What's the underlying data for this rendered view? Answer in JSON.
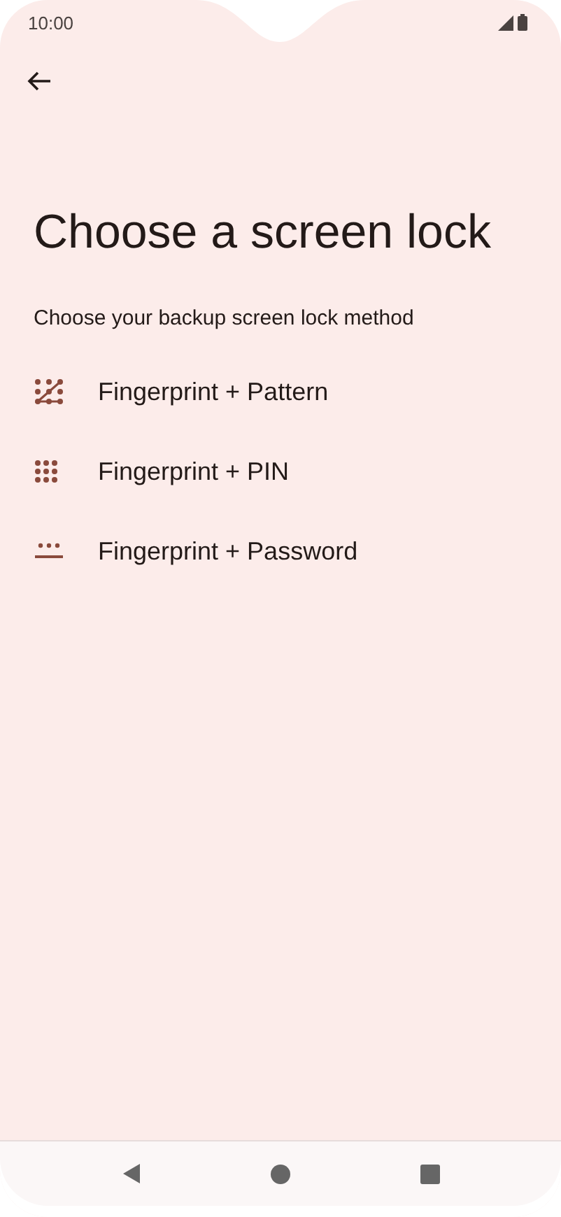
{
  "status_bar": {
    "time": "10:00"
  },
  "title": "Choose a screen lock",
  "subtitle": "Choose your backup screen lock method",
  "options": [
    {
      "kind": "pattern",
      "label": "Fingerprint + Pattern"
    },
    {
      "kind": "pin",
      "label": "Fingerprint + PIN"
    },
    {
      "kind": "password",
      "label": "Fingerprint + Password"
    }
  ]
}
